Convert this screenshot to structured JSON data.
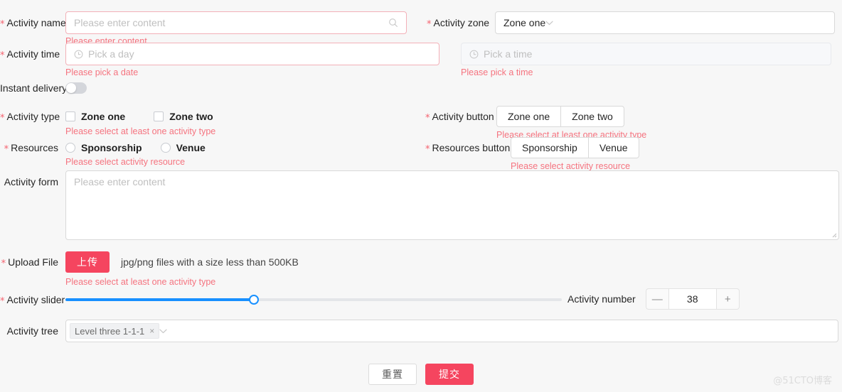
{
  "fields": {
    "activity_name": {
      "label": "Activity name",
      "required": true,
      "placeholder": "Please enter content",
      "value": "",
      "error": "Please enter content",
      "icon": "search-icon"
    },
    "activity_zone": {
      "label": "Activity zone",
      "required": true,
      "value": "Zone one",
      "icon": "chevron-down-icon"
    },
    "activity_time": {
      "label": "Activity time",
      "required": true,
      "placeholder": "Pick a day",
      "value": "",
      "error": "Please pick a date",
      "icon": "clock-icon"
    },
    "activity_time_to": {
      "placeholder": "Pick a time",
      "value": "",
      "error": "Please pick a time",
      "icon": "clock-icon",
      "disabled": true
    },
    "instant_delivery": {
      "label": "Instant delivery",
      "required": false,
      "checked": false
    },
    "activity_type": {
      "label": "Activity type",
      "required": true,
      "error": "Please select at least one activity type",
      "options": [
        {
          "label": "Zone one",
          "checked": false
        },
        {
          "label": "Zone two",
          "checked": false
        }
      ]
    },
    "activity_button": {
      "label": "Activity button",
      "required": true,
      "error": "Please select at least one activity type",
      "options": [
        {
          "label": "Zone one",
          "selected": false
        },
        {
          "label": "Zone two",
          "selected": false
        }
      ]
    },
    "resources": {
      "label": "Resources",
      "required": true,
      "error": "Please select activity resource",
      "options": [
        {
          "label": "Sponsorship",
          "checked": false
        },
        {
          "label": "Venue",
          "checked": false
        }
      ]
    },
    "resources_button": {
      "label": "Resources button",
      "required": true,
      "error": "Please select activity resource",
      "options": [
        {
          "label": "Sponsorship",
          "selected": false
        },
        {
          "label": "Venue",
          "selected": false
        }
      ]
    },
    "activity_form": {
      "label": "Activity form",
      "required": false,
      "placeholder": "Please enter content",
      "value": ""
    },
    "upload_file": {
      "label": "Upload File",
      "required": true,
      "button_label": "上传",
      "hint": "jpg/png files with a size less than 500KB",
      "error": "Please select at least one activity type"
    },
    "activity_slider": {
      "label": "Activity slider",
      "required": true,
      "value": 38,
      "min": 0,
      "max": 100
    },
    "activity_number": {
      "label": "Activity number",
      "required": false,
      "value": "38",
      "minus_label": "—",
      "plus_label": "+"
    },
    "activity_tree": {
      "label": "Activity tree",
      "required": false,
      "tags": [
        {
          "label": "Level three 1-1-1",
          "close": "×"
        }
      ],
      "icon": "chevron-down-icon"
    }
  },
  "footer": {
    "reset_label": "重置",
    "submit_label": "提交"
  },
  "watermark": "@51CTO博客",
  "colors": {
    "accent_red": "#f5455f",
    "error_text": "#f5737f",
    "error_border": "#f3b0b8",
    "slider_blue": "#1890ff",
    "page_bg": "#f7f7f7"
  }
}
